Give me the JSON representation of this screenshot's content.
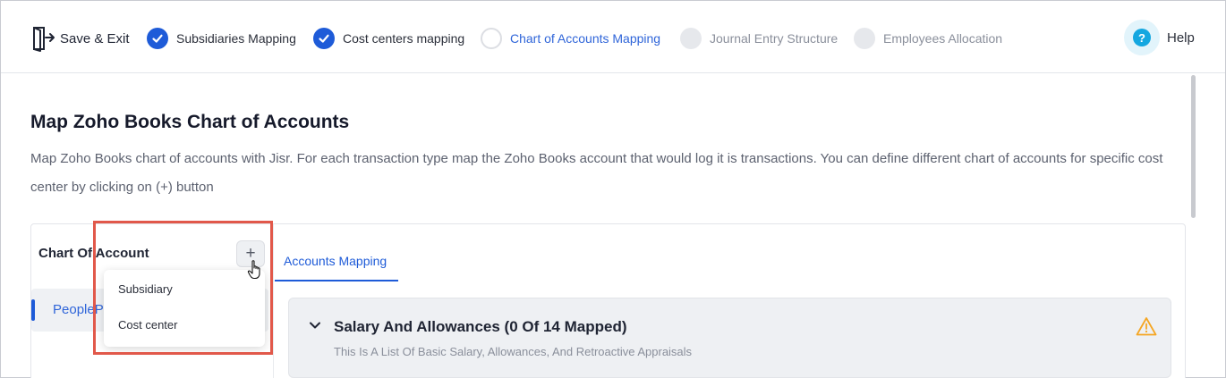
{
  "header": {
    "save_exit_label": "Save & Exit",
    "steps": [
      {
        "label": "Subsidiaries Mapping",
        "state": "done"
      },
      {
        "label": "Cost centers mapping",
        "state": "done"
      },
      {
        "label": "Chart of Accounts Mapping",
        "state": "current"
      },
      {
        "label": "Journal Entry Structure",
        "state": "todo"
      },
      {
        "label": "Employees Allocation",
        "state": "todo"
      }
    ],
    "help_label": "Help",
    "help_icon_glyph": "?"
  },
  "page": {
    "title": "Map Zoho Books Chart of Accounts",
    "description": "Map Zoho Books chart of accounts with Jisr. For each transaction type map the Zoho Books account that would log it is transactions. You can define different chart of accounts for specific cost center by clicking on (+) button"
  },
  "left_panel": {
    "title": "Chart Of Account",
    "add_glyph": "+",
    "selected_item": "PeoplePl"
  },
  "tabs": [
    {
      "label": "Accounts Mapping",
      "active": true
    }
  ],
  "section": {
    "title": "Salary And Allowances (0 Of 14 Mapped)",
    "subtitle": "This Is A List Of Basic Salary, Allowances, And Retroactive Appraisals",
    "status_icon": "warning-icon"
  },
  "dropdown": {
    "items": [
      "Subsidiary",
      "Cost center"
    ]
  },
  "colors": {
    "primary": "#1e5bd8",
    "warning": "#f5a623",
    "highlight": "#e1584a"
  }
}
